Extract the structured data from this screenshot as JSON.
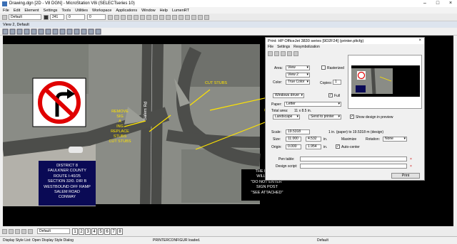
{
  "window": {
    "title": "Drawing.dgn [2D - V8 DGN] - MicroStation V8i (SELECTseries 10)"
  },
  "menu": [
    "File",
    "Edit",
    "Element",
    "Settings",
    "Tools",
    "Utilities",
    "Workspace",
    "Applications",
    "Window",
    "Help",
    "LumenRT"
  ],
  "toolbar": {
    "level": "Default",
    "color_num": "241",
    "weight": "0",
    "style": "0"
  },
  "view": {
    "title": "View 2, Default"
  },
  "drawing": {
    "road_label": "Salem Rd",
    "cut_stubs_1": "CUT STUBS",
    "cut_stubs_2": "CUT STUBS",
    "remove_lines": [
      "REMOVE",
      "SIG",
      "A",
      "ING",
      "REPLACE",
      "STUBS",
      "CUT STUBS"
    ],
    "district_box": [
      "DISTRICT 8",
      "FAULKNER COUNTY",
      "ROUTE I-40/25",
      "SECTION 32/0. DIR B",
      "WESTBOUND OFF RAMP",
      "SALEM ROAD",
      "CONWAY"
    ],
    "note_box": [
      "THE RED VE",
      "WILL NEED",
      "\"DO NOT ENTER\"",
      "SIGN POST",
      "\"SEE ATTACHED\""
    ]
  },
  "print_dialog": {
    "title": "Print: HP OfficeJet 3830 series [9D2F24] (printer.pltcfg)",
    "menu": [
      "File",
      "Settings",
      "Resymbolization"
    ],
    "area_label": "Area:",
    "area_value": "View",
    "view_value": "View 2",
    "color_label": "Color:",
    "color_value": "True Color",
    "rasterized_label": "Rasterized",
    "copies_label": "Copies:",
    "copies_value": "1",
    "driver_value": "Windows driver",
    "full_label": "Full",
    "paper_label": "Paper:",
    "paper_value": "Letter",
    "total_area_label": "Total area:",
    "total_area_value": "11 x 8.5 in.",
    "orientation_value": "Landscape",
    "send_to_value": "Send to printer",
    "show_design_label": "Show design in preview",
    "scale_label": "Scale:",
    "scale_value": "19.5318",
    "scale_desc": "1 in. (paper) to 19.5318 m (design)",
    "size_label": "Size:",
    "size_w": "11.000",
    "size_h": "4.532",
    "size_unit": "in.",
    "maximize_label": "Maximize",
    "rotation_label": "Rotation:",
    "rotation_value": "None",
    "origin_label": "Origin:",
    "origin_x": "0.000",
    "origin_y": "1.954",
    "origin_unit": "in.",
    "autocenter_label": "Auto-center",
    "pen_table_label": "Pen table:",
    "design_script_label": "Design script:",
    "print_button": "Print"
  },
  "bottom": {
    "pages": [
      "1",
      "2",
      "3",
      "4",
      "5",
      "6",
      "7",
      "8"
    ],
    "model": "Default"
  },
  "status": {
    "left": "Display Style List: Open Display Style Dialog",
    "middle": "PRINTERCONFIGUR loaded.",
    "right": "Default"
  }
}
